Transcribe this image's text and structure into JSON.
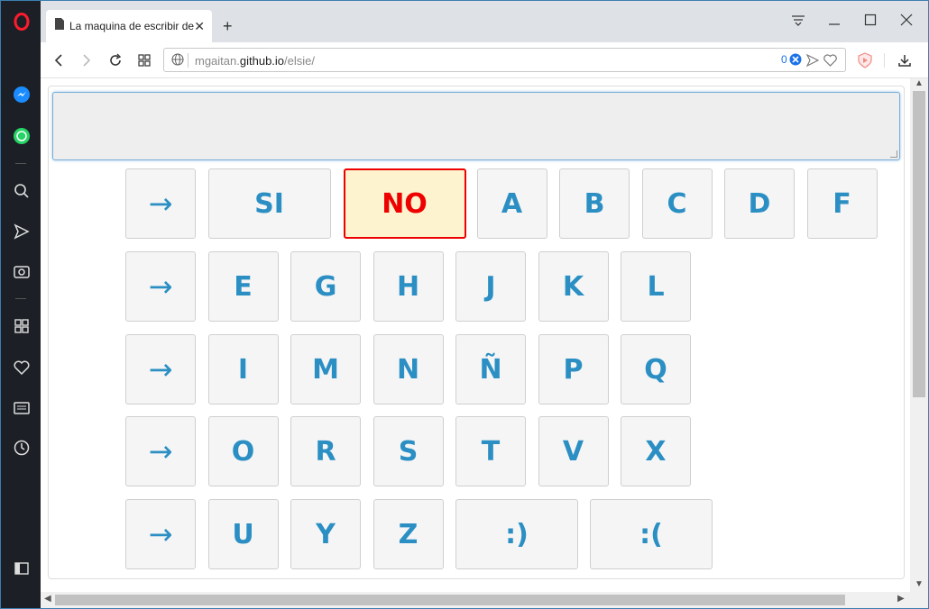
{
  "browser": {
    "tab_title": "La maquina de escribir de Elsie",
    "url_domain_prefix": "mgaitan.",
    "url_domain": "github.io",
    "url_path": "/elsie/",
    "badge_count": "0"
  },
  "keyboard": {
    "rows": [
      [
        "→",
        "SI",
        "NO",
        "A",
        "B",
        "C",
        "D",
        "F"
      ],
      [
        "→",
        "E",
        "G",
        "H",
        "J",
        "K",
        "L"
      ],
      [
        "→",
        "I",
        "M",
        "N",
        "Ñ",
        "P",
        "Q"
      ],
      [
        "→",
        "O",
        "R",
        "S",
        "T",
        "V",
        "X"
      ],
      [
        "→",
        "U",
        "Y",
        "Z",
        ":)",
        ":("
      ]
    ],
    "selected": "NO"
  },
  "colors": {
    "key_text": "#2b8fc4",
    "selected_border": "#e00000",
    "selected_bg": "#fdf3cf"
  },
  "icons": [
    "opera-logo-icon",
    "messenger-icon",
    "whatsapp-icon",
    "search-icon",
    "send-icon",
    "camera-icon",
    "speed-dial-icon",
    "heart-icon",
    "news-icon",
    "history-icon",
    "sidebar-toggle-icon"
  ]
}
